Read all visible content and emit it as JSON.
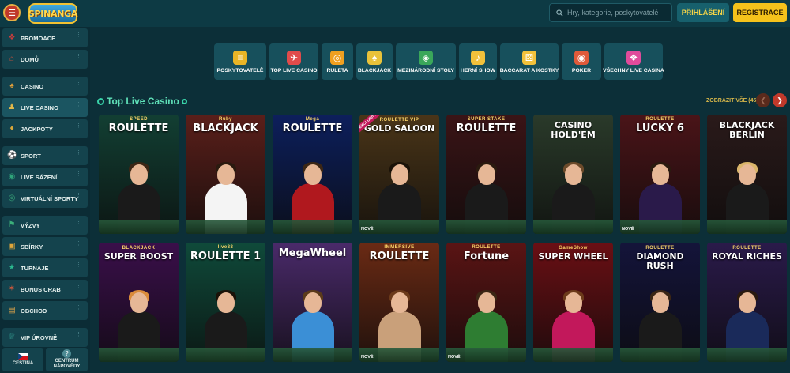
{
  "header": {
    "logo_text": "SPINANGA",
    "search_placeholder": "Hry, kategorie, poskytovatelé",
    "login_label": "PŘIHLÁŠENÍ",
    "register_label": "REGISTRACE"
  },
  "sidebar": {
    "items": [
      {
        "label": "PROMOACE",
        "icon": "gift-icon"
      },
      {
        "label": "DOMŮ",
        "icon": "home-icon"
      },
      {
        "label": "CASINO",
        "icon": "slot-machine-icon"
      },
      {
        "label": "LIVE CASINO",
        "icon": "live-dealer-icon"
      },
      {
        "label": "JACKPOTY",
        "icon": "jackpot-icon"
      },
      {
        "label": "SPORT",
        "icon": "soccer-ball-icon"
      },
      {
        "label": "LIVE SÁZENÍ",
        "icon": "live-betting-icon"
      },
      {
        "label": "VIRTUÁLNÍ SPORTY",
        "icon": "virtual-sports-icon"
      },
      {
        "label": "VÝZVY",
        "icon": "challenges-icon"
      },
      {
        "label": "SBÍRKY",
        "icon": "collections-icon"
      },
      {
        "label": "TURNAJE",
        "icon": "tournament-icon"
      },
      {
        "label": "BONUS CRAB",
        "icon": "crab-icon"
      },
      {
        "label": "OBCHOD",
        "icon": "shop-icon"
      },
      {
        "label": "VIP ÚROVNĚ",
        "icon": "vip-icon"
      }
    ],
    "language_label": "ČEŠTINA",
    "help_label_1": "CENTRUM",
    "help_label_2": "NÁPOVĚDY"
  },
  "categories": [
    {
      "label": "POSKYTOVATELÉ",
      "icon": "providers-icon",
      "color": "#e9b526"
    },
    {
      "label": "TOP LIVE CASINO",
      "icon": "rocket-icon",
      "color": "#e04b4b"
    },
    {
      "label": "RULETA",
      "icon": "roulette-icon",
      "color": "#f0a020"
    },
    {
      "label": "BLACKJACK",
      "icon": "cards-icon",
      "color": "#e8c23a"
    },
    {
      "label": "MEZINÁRODNÍ STOLY",
      "icon": "globe-cards-icon",
      "color": "#3aa75a"
    },
    {
      "label": "HERNÍ SHOW",
      "icon": "microphone-icon",
      "color": "#f2c13b"
    },
    {
      "label": "BACCARAT A KOSTKY",
      "icon": "dice-icon",
      "color": "#f2c13b"
    },
    {
      "label": "POKER",
      "icon": "poker-chip-icon",
      "color": "#e05a3a"
    },
    {
      "label": "VŠECHNY LIVE CASINA",
      "icon": "all-games-icon",
      "color": "#e04b9b"
    }
  ],
  "section": {
    "title": "Top Live Casino",
    "show_all": "ZOBRAZIT VŠE (45)"
  },
  "games_row1": [
    {
      "title": "ROULETTE",
      "sub": "SPEED",
      "bg": "#123f33",
      "body": "#1a1a1a"
    },
    {
      "title": "BLACKJACK",
      "sub": "Ruby",
      "bg": "#5a1f1a",
      "body": "#f4f4f4"
    },
    {
      "title": "ROULETTE",
      "sub": "Mega",
      "bg": "#0d1f5c",
      "body": "#b0181e"
    },
    {
      "title": "GOLD SALOON",
      "sub": "ROULETTE VIP",
      "bg": "#4a3518",
      "body": "#1a1a1a"
    },
    {
      "title": "ROULETTE",
      "sub": "SUPER STAKE",
      "bg": "#3a1416",
      "body": "#1a1a1a"
    },
    {
      "title": "CASINO HOLD'EM",
      "sub": "",
      "bg": "#2a3a2a",
      "body": "#1a1a1a"
    },
    {
      "title": "LUCKY 6",
      "sub": "ROULETTE",
      "bg": "#4a1418",
      "body": "#2a1a4a"
    },
    {
      "title": "BLACKJACK BERLIN",
      "sub": "",
      "bg": "#2a1a1a",
      "body": "#1a1a1a"
    }
  ],
  "games_row2": [
    {
      "title": "SUPER BOOST",
      "sub": "BLACKJACK",
      "bg": "#3a0f4a",
      "body": "#1a1a1a"
    },
    {
      "title": "ROULETTE 1",
      "sub": "live88",
      "bg": "#0f4a3a",
      "body": "#1a1a1a"
    },
    {
      "title": "MegaWheel",
      "sub": "",
      "bg": "#4a2a6a",
      "body": "#3b8fd6"
    },
    {
      "title": "ROULETTE",
      "sub": "IMMERSIVE",
      "bg": "#6a2a14",
      "body": "#c9a07a"
    },
    {
      "title": "Fortune",
      "sub": "ROULETTE",
      "bg": "#5a1414",
      "body": "#2e7d32"
    },
    {
      "title": "SUPER WHEEL",
      "sub": "GameShow",
      "bg": "#6a0f14",
      "body": "#c2185b"
    },
    {
      "title": "DIAMOND RUSH",
      "sub": "ROULETTE",
      "bg": "#14143a",
      "body": "#1a1a1a"
    },
    {
      "title": "ROYAL RICHES",
      "sub": "ROULETTE",
      "bg": "#2a1a4a",
      "body": "#1a2a5a"
    }
  ],
  "badges": {
    "new": "NOVÉ",
    "corner": "EXCLUSIVE"
  }
}
